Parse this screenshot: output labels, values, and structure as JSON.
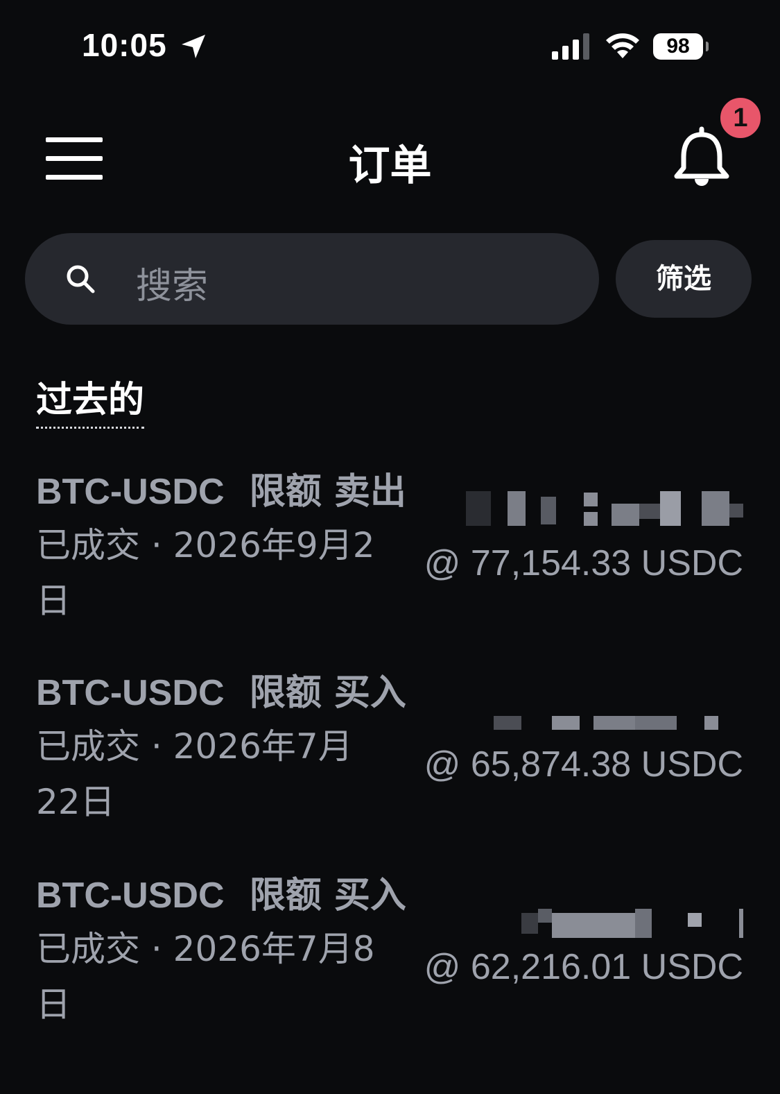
{
  "status_bar": {
    "time": "10:05",
    "battery": "98",
    "icons": [
      "location-arrow-icon",
      "cellular-signal-icon",
      "wifi-icon",
      "battery-icon"
    ]
  },
  "header": {
    "title": "订单",
    "notification_count": "1",
    "icons": [
      "menu-icon",
      "bell-icon"
    ]
  },
  "search": {
    "placeholder": "搜索",
    "filter_label": "筛选"
  },
  "section": {
    "title": "过去的"
  },
  "orders": [
    {
      "pair": "BTC-USDC",
      "type": "限额",
      "side": "卖出",
      "status": "已成交 · 2026年9月2日",
      "price": "@ 77,154.33 USDC"
    },
    {
      "pair": "BTC-USDC",
      "type": "限额",
      "side": "买入",
      "status": "已成交 · 2026年7月22日",
      "price": "@ 65,874.38 USDC"
    },
    {
      "pair": "BTC-USDC",
      "type": "限额",
      "side": "买入",
      "status": "已成交 · 2026年7月8日",
      "price": "@ 62,216.01 USDC"
    }
  ],
  "colors": {
    "background": "#0a0b0d",
    "surface": "#26282e",
    "muted_text": "#9fa3ad",
    "badge": "#e8566a"
  }
}
